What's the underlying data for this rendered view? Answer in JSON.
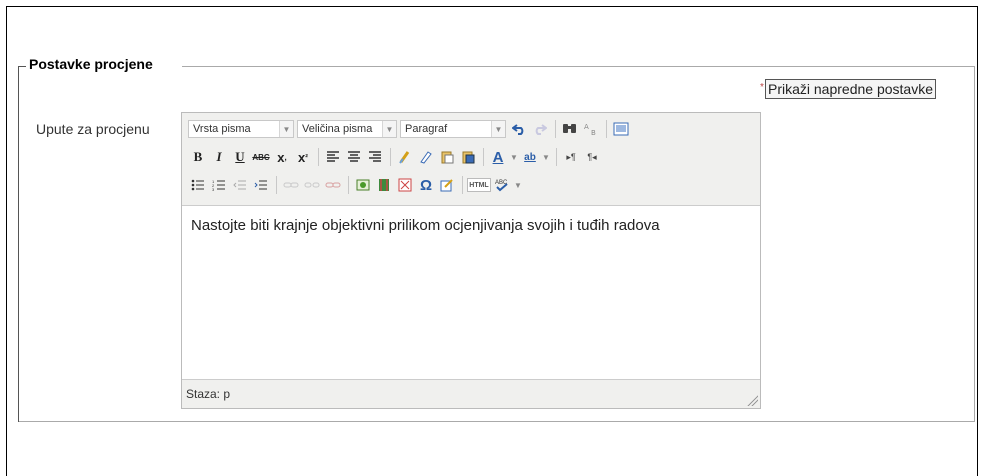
{
  "section": {
    "legend": "Postavke procjene",
    "advanced_star": "*",
    "advanced_button": "Prikaži napredne postavke"
  },
  "field": {
    "label": "Upute za procjenu"
  },
  "editor": {
    "toolbar": {
      "font_family": "Vrsta pisma",
      "font_size": "Veličina pisma",
      "format": "Paragraf"
    },
    "content": "Nastojte biti krajnje objektivni prilikom ocjenjivanja svojih i tuđih radova",
    "status_path": "Staza: p"
  },
  "icons": {
    "undo": "undo-icon",
    "redo": "redo-icon",
    "find": "search-icon",
    "replace": "replace-icon",
    "fullscreen": "fullscreen-icon",
    "bold": "B",
    "italic": "I",
    "underline": "U",
    "strike": "ABC",
    "subscript": "x₂",
    "superscript": "x²",
    "html": "HTML"
  },
  "colors": {
    "toolbar_bg": "#f0f0ee",
    "border": "#bbbbbb",
    "accent_blue": "#2b5ea8"
  }
}
